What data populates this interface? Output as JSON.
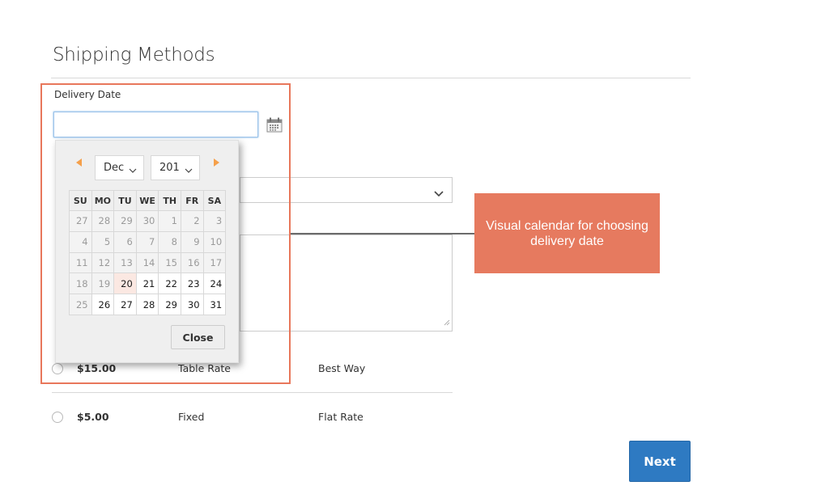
{
  "page": {
    "title": "Shipping Methods"
  },
  "delivery_date": {
    "label": "Delivery Date",
    "value": "",
    "placeholder": "",
    "trigger_icon": "calendar-icon"
  },
  "calendar": {
    "prev_icon": "triangle-left-icon",
    "next_icon": "triangle-right-icon",
    "month_selected": "Dec",
    "year_selected": "201",
    "weekdays": [
      "SU",
      "MO",
      "TU",
      "WE",
      "TH",
      "FR",
      "SA"
    ],
    "weeks": [
      [
        {
          "d": "27",
          "s": "off"
        },
        {
          "d": "28",
          "s": "off"
        },
        {
          "d": "29",
          "s": "off"
        },
        {
          "d": "30",
          "s": "off"
        },
        {
          "d": "1",
          "s": "off"
        },
        {
          "d": "2",
          "s": "off"
        },
        {
          "d": "3",
          "s": "off"
        }
      ],
      [
        {
          "d": "4",
          "s": "off"
        },
        {
          "d": "5",
          "s": "off"
        },
        {
          "d": "6",
          "s": "off"
        },
        {
          "d": "7",
          "s": "off"
        },
        {
          "d": "8",
          "s": "off"
        },
        {
          "d": "9",
          "s": "off"
        },
        {
          "d": "10",
          "s": "off"
        }
      ],
      [
        {
          "d": "11",
          "s": "off"
        },
        {
          "d": "12",
          "s": "off"
        },
        {
          "d": "13",
          "s": "off"
        },
        {
          "d": "14",
          "s": "off"
        },
        {
          "d": "15",
          "s": "off"
        },
        {
          "d": "16",
          "s": "off"
        },
        {
          "d": "17",
          "s": "off"
        }
      ],
      [
        {
          "d": "18",
          "s": "off"
        },
        {
          "d": "19",
          "s": "off"
        },
        {
          "d": "20",
          "s": "today"
        },
        {
          "d": "21",
          "s": "on"
        },
        {
          "d": "22",
          "s": "on"
        },
        {
          "d": "23",
          "s": "on"
        },
        {
          "d": "24",
          "s": "on"
        }
      ],
      [
        {
          "d": "25",
          "s": "off"
        },
        {
          "d": "26",
          "s": "on"
        },
        {
          "d": "27",
          "s": "on"
        },
        {
          "d": "28",
          "s": "on"
        },
        {
          "d": "29",
          "s": "on"
        },
        {
          "d": "30",
          "s": "on"
        },
        {
          "d": "31",
          "s": "on"
        }
      ]
    ],
    "close_label": "Close"
  },
  "callout": {
    "text": "Visual calendar for choosing delivery date",
    "color": "#e67a5f"
  },
  "shipping_options": [
    {
      "price": "$15.00",
      "method": "Table Rate",
      "carrier": "Best Way",
      "selected": false
    },
    {
      "price": "$5.00",
      "method": "Fixed",
      "carrier": "Flat Rate",
      "selected": false
    }
  ],
  "actions": {
    "next_label": "Next",
    "next_color": "#2e7ac2"
  },
  "colors": {
    "highlight_border": "#e8775b",
    "arrow_accent": "#f5a04a",
    "today_bg": "#fbe8e2"
  }
}
